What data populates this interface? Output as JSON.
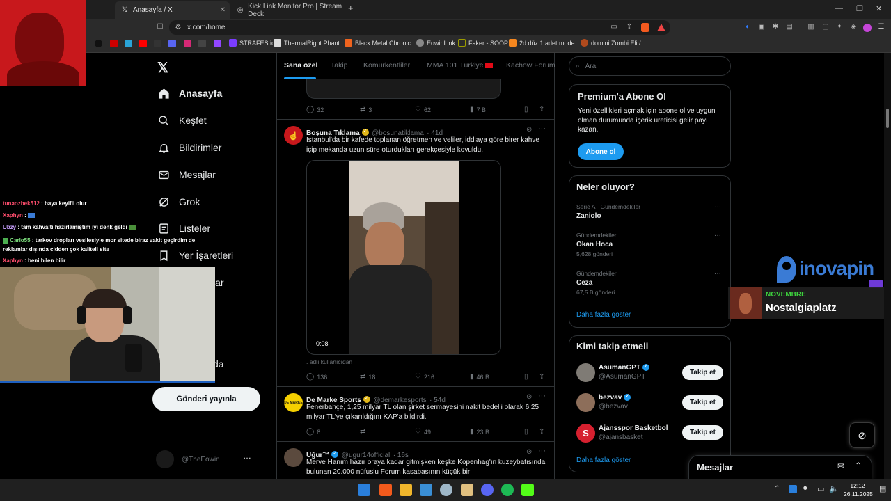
{
  "browser": {
    "tabs": [
      {
        "title": "Anasayfa / X",
        "icon": "x-logo-icon"
      },
      {
        "title": "Kick Link Monitor Pro | Stream Deck",
        "icon": "globe-icon"
      }
    ],
    "url": "x.com/home",
    "bookmarks": [
      "STRAFES.io",
      "ThermalRight Phant...",
      "Black Metal Chronic...",
      "EowinLink",
      "Faker - SOOP",
      "2d düz 1 adet mode...",
      "domini Zombi Eli /..."
    ]
  },
  "x": {
    "nav": [
      "Anasayfa",
      "Keşfet",
      "Bildirimler",
      "Mesajlar",
      "Grok",
      "Listeler",
      "Yer İşaretleri",
      "lar",
      "",
      "",
      "da"
    ],
    "post_button": "Gönderi yayınla",
    "account_handle": "@TheEowin",
    "feed_tabs": [
      "Sana özel",
      "Takip",
      "Kömürkentliler",
      "MMA 101 Türkiye",
      "Kachow Forum"
    ],
    "prev_tweet_actions": {
      "replies": "32",
      "retweets": "3",
      "likes": "62",
      "views": "7 B"
    },
    "tweets": [
      {
        "name": "Boşuna Tıklama",
        "handle": "@bosunatiklama",
        "time": "· 41d",
        "text": "İstanbul'da bir kafede toplanan öğretmen ve veliler, iddiaya göre birer kahve içip mekanda uzun süre oturdukları gerekçesiyle kovuldu.",
        "video_time": "0:08",
        "note": ". adlı kullanıcıdan",
        "replies": "136",
        "retweets": "18",
        "likes": "216",
        "views": "46 B"
      },
      {
        "name": "De Marke Sports",
        "handle": "@demarkesports",
        "time": "· 54d",
        "text": "Fenerbahçe, 1,25 milyar TL olan şirket sermayesini nakit bedelli olarak 6,25 milyar TL'ye çıkarıldığını KAP'a bildirdi.",
        "replies": "8",
        "retweets": "",
        "likes": "49",
        "views": "23 B"
      },
      {
        "name": "Uğur™",
        "handle": "@ugur14official",
        "time": "· 16s",
        "text": "Merve Hanım hazır oraya kadar gitmişken keşke Kopenhag'ın kuzeybatısında bulunan 20.000 nüfuslu Forum kasabasının küçük bir"
      }
    ],
    "search_placeholder": "Ara",
    "premium": {
      "title": "Premium'a Abone Ol",
      "text": "Yeni özellikleri açmak için abone ol ve uygun olman durumunda içerik üreticisi gelir payı kazan.",
      "button": "Abone ol"
    },
    "trends": {
      "title": "Neler oluyor?",
      "items": [
        {
          "context": "Serie A · Gündemdekiler",
          "name": "Zaniolo",
          "count": ""
        },
        {
          "context": "Gündemdekiler",
          "name": "Okan Hoca",
          "count": "5,628 gönderi"
        },
        {
          "context": "Gündemdekiler",
          "name": "Ceza",
          "count": "67,5 B gönderi"
        }
      ],
      "more": "Daha fazla göster"
    },
    "who_to_follow": {
      "title": "Kimi takip etmeli",
      "items": [
        {
          "name": "AsumanGPT",
          "handle": "@AsumanGPT",
          "button": "Takip et"
        },
        {
          "name": "bezvav",
          "handle": "@bezvav",
          "button": "Takip et"
        },
        {
          "name": "Ajansspor Basketbol",
          "handle": "@ajansbasket",
          "button": "Takip et"
        }
      ],
      "more": "Daha fazla göster"
    },
    "messages_drawer": "Mesajlar"
  },
  "overlay": {
    "chat": [
      {
        "user": "tunaozbek512",
        "text": ": baya keyifli olur",
        "color": "#ff4d6d"
      },
      {
        "user": "Xaphyn",
        "text": ":",
        "color": "#ff4d6d"
      },
      {
        "user": "Ubzy",
        "text": ": tam kahvaltı hazırlamıştım iyi denk geldi",
        "color": "#c9a0ff"
      },
      {
        "user": "Carlo55",
        "text": ": tarkov dropları vesilesiyle mor sitede biraz vakit geçirdim de reklamlar dışında cidden çok kaliteli site",
        "color": "#7ee07e"
      },
      {
        "user": "Xaphyn",
        "text": ": beni bilen bilir",
        "color": "#ff4d6d"
      }
    ],
    "sponsor": "inovapin",
    "now_playing": {
      "month": "NOVEMBRE",
      "title": "Nostalgiaplatz"
    }
  },
  "taskbar": {
    "time": "12:12",
    "date": "26.11.2025"
  }
}
